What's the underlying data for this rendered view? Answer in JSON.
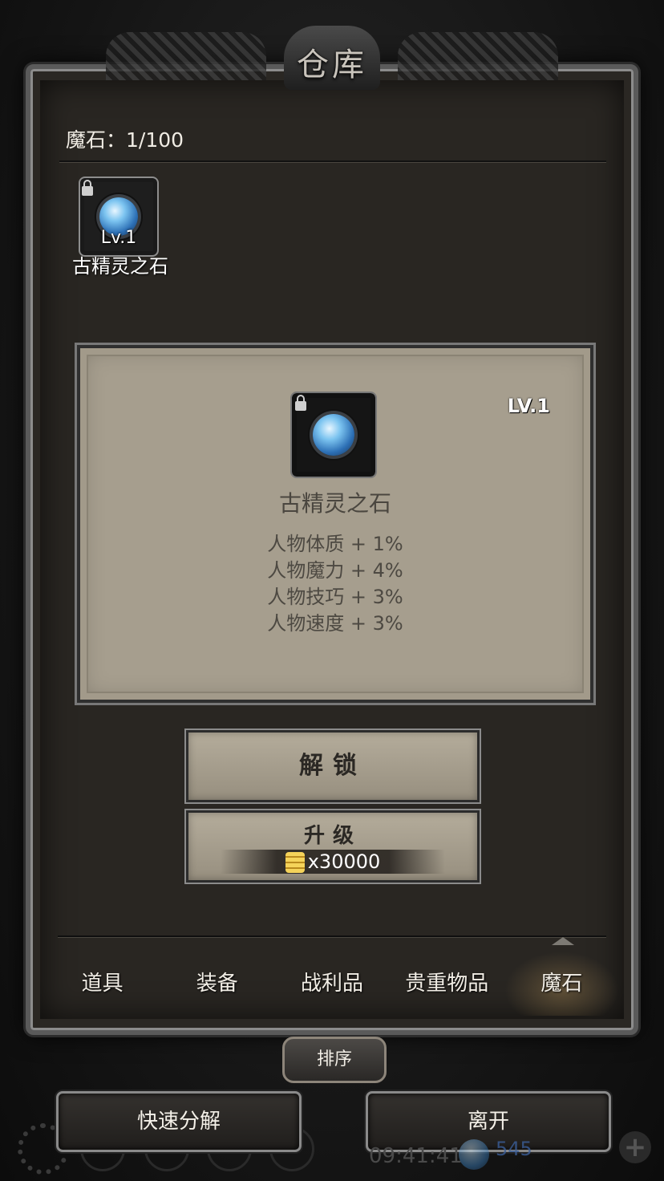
{
  "window": {
    "title": "仓库"
  },
  "inventory": {
    "capacity": "魔石：1/100"
  },
  "slot": {
    "level": "Lv.1",
    "name": "古精灵之石",
    "locked": true,
    "icon": "blue-magic-stone-icon"
  },
  "detail": {
    "level": "LV.1",
    "name": "古精灵之石",
    "stats": [
      "人物体质 + 1%",
      "人物魔力 + 4%",
      "人物技巧 + 3%",
      "人物速度 + 3%"
    ]
  },
  "actions": {
    "unlock": "解锁",
    "upgrade": "升级",
    "upgrade_cost": "x30000"
  },
  "tabs": [
    "道具",
    "装备",
    "战利品",
    "贵重物品",
    "魔石"
  ],
  "active_tab": "魔石",
  "sort_label": "排序",
  "bottom": {
    "quick_decompose": "快速分解",
    "leave": "离开"
  },
  "status": {
    "time": "09:41:41",
    "gems": "545"
  },
  "colors": {
    "panel": "#a69e8e",
    "frame": "#5a5a5a",
    "background": "#292622"
  }
}
